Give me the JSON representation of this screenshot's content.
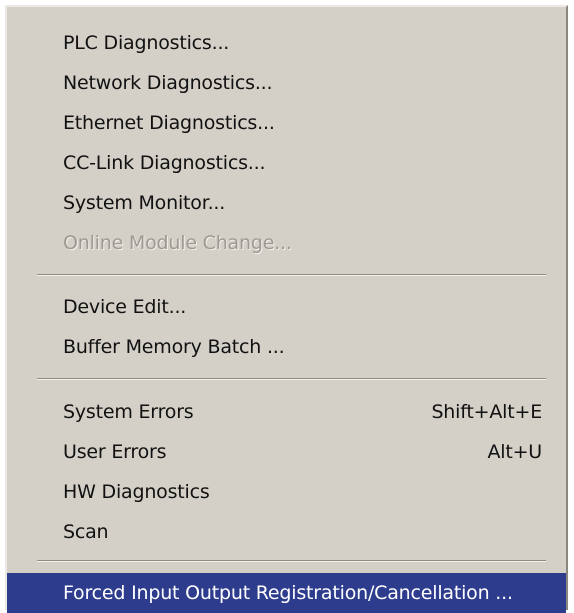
{
  "menu": {
    "items": [
      {
        "label": "PLC Diagnostics...",
        "enabled": true
      },
      {
        "label": "Network Diagnostics...",
        "enabled": true
      },
      {
        "label": "Ethernet Diagnostics...",
        "enabled": true
      },
      {
        "label": "CC-Link Diagnostics...",
        "enabled": true
      },
      {
        "label": "System Monitor...",
        "enabled": true
      },
      {
        "label": "Online Module Change...",
        "enabled": false
      },
      {
        "label": "Device Edit...",
        "enabled": true
      },
      {
        "label": "Buffer Memory Batch ...",
        "enabled": true
      },
      {
        "label": "System Errors",
        "shortcut": "Shift+Alt+E",
        "enabled": true
      },
      {
        "label": "User Errors",
        "shortcut": "Alt+U",
        "enabled": true
      },
      {
        "label": "HW Diagnostics",
        "enabled": true
      },
      {
        "label": "Scan",
        "enabled": true
      },
      {
        "label": "Forced Input Output Registration/Cancellation ...",
        "enabled": true,
        "highlighted": true
      }
    ]
  },
  "colors": {
    "menu_background": "#d4d0c8",
    "highlight_background": "#2e3c8d",
    "disabled_text": "#9d9a94"
  }
}
